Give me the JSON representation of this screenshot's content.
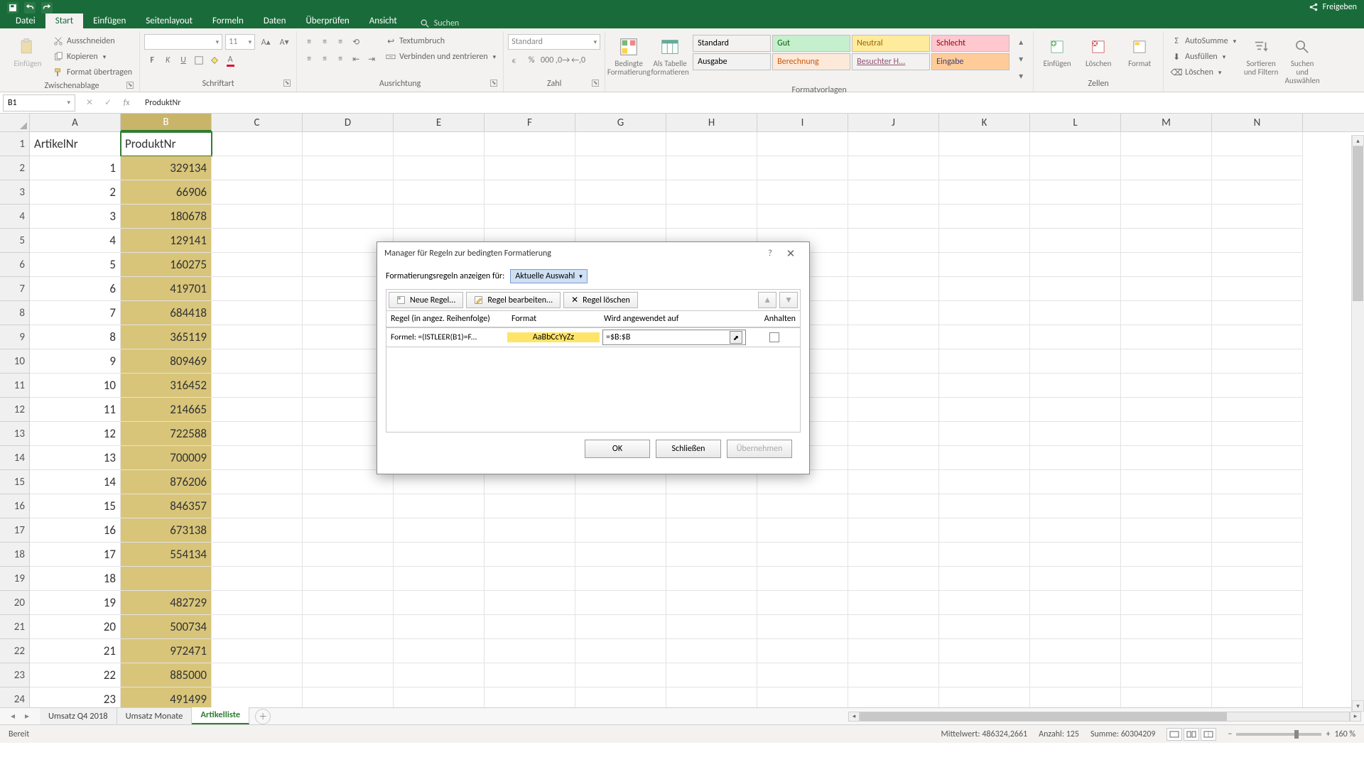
{
  "titlebar": {
    "share": "Freigeben"
  },
  "tabs": {
    "file": "Datei",
    "items": [
      "Start",
      "Einfügen",
      "Seitenlayout",
      "Formeln",
      "Daten",
      "Überprüfen",
      "Ansicht"
    ],
    "active": "Start",
    "search": "Suchen"
  },
  "ribbon": {
    "clipboard": {
      "label": "Zwischenablage",
      "paste": "Einfügen",
      "cut": "Ausschneiden",
      "copy": "Kopieren",
      "format_painter": "Format übertragen"
    },
    "font": {
      "label": "Schriftart",
      "font_name": "",
      "font_size": "11"
    },
    "alignment": {
      "label": "Ausrichtung",
      "wrap": "Textumbruch",
      "merge": "Verbinden und zentrieren"
    },
    "number": {
      "label": "Zahl",
      "format": "Standard"
    },
    "styles": {
      "label": "Formatvorlagen",
      "cond": "Bedingte Formatierung",
      "table": "Als Tabelle formatieren",
      "cells": {
        "standard": "Standard",
        "gut": "Gut",
        "neutral": "Neutral",
        "schlecht": "Schlecht",
        "ausgabe": "Ausgabe",
        "berechnung": "Berechnung",
        "besuchter": "Besuchter H...",
        "eingabe": "Eingabe"
      }
    },
    "cells_group": {
      "label": "Zellen",
      "insert": "Einfügen",
      "delete": "Löschen",
      "format": "Format"
    },
    "editing": {
      "autosum": "AutoSumme",
      "fill": "Ausfüllen",
      "clear": "Löschen",
      "sort": "Sortieren und Filtern",
      "find": "Suchen und Auswählen"
    }
  },
  "formula_bar": {
    "name_box": "B1",
    "formula": "ProduktNr"
  },
  "columns": [
    "A",
    "B",
    "C",
    "D",
    "E",
    "F",
    "G",
    "H",
    "I",
    "J",
    "K",
    "L",
    "M",
    "N"
  ],
  "selected_col": "B",
  "rows": [
    {
      "n": 1,
      "A": "ArtikelNr",
      "B": "ProduktNr",
      "isHeader": true
    },
    {
      "n": 2,
      "A": "1",
      "B": "329134"
    },
    {
      "n": 3,
      "A": "2",
      "B": "66906"
    },
    {
      "n": 4,
      "A": "3",
      "B": "180678"
    },
    {
      "n": 5,
      "A": "4",
      "B": "129141"
    },
    {
      "n": 6,
      "A": "5",
      "B": "160275"
    },
    {
      "n": 7,
      "A": "6",
      "B": "419701"
    },
    {
      "n": 8,
      "A": "7",
      "B": "684418"
    },
    {
      "n": 9,
      "A": "8",
      "B": "365119"
    },
    {
      "n": 10,
      "A": "9",
      "B": "809469"
    },
    {
      "n": 11,
      "A": "10",
      "B": "316452"
    },
    {
      "n": 12,
      "A": "11",
      "B": "214665"
    },
    {
      "n": 13,
      "A": "12",
      "B": "722588"
    },
    {
      "n": 14,
      "A": "13",
      "B": "700009"
    },
    {
      "n": 15,
      "A": "14",
      "B": "876206"
    },
    {
      "n": 16,
      "A": "15",
      "B": "846357"
    },
    {
      "n": 17,
      "A": "16",
      "B": "673138"
    },
    {
      "n": 18,
      "A": "17",
      "B": "554134"
    },
    {
      "n": 19,
      "A": "18",
      "B": ""
    },
    {
      "n": 20,
      "A": "19",
      "B": "482729"
    },
    {
      "n": 21,
      "A": "20",
      "B": "500734"
    },
    {
      "n": 22,
      "A": "21",
      "B": "972471"
    },
    {
      "n": 23,
      "A": "22",
      "B": "885000"
    },
    {
      "n": 24,
      "A": "23",
      "B": "491499"
    }
  ],
  "sheets": {
    "tabs": [
      "Umsatz Q4 2018",
      "Umsatz Monate",
      "Artikelliste"
    ],
    "active": "Artikelliste"
  },
  "statusbar": {
    "ready": "Bereit",
    "avg_label": "Mittelwert:",
    "avg": "486324,2661",
    "count_label": "Anzahl:",
    "count": "125",
    "sum_label": "Summe:",
    "sum": "60304209",
    "zoom": "160 %"
  },
  "dialog": {
    "title": "Manager für Regeln zur bedingten Formatierung",
    "show_for_label": "Formatierungsregeln anzeigen für:",
    "show_for_value": "Aktuelle Auswahl",
    "btn_new": "Neue Regel...",
    "btn_edit": "Regel bearbeiten...",
    "btn_delete": "Regel löschen",
    "col_rule": "Regel (in angez. Reihenfolge)",
    "col_format": "Format",
    "col_applies": "Wird angewendet auf",
    "col_stop": "Anhalten",
    "rule1_text": "Formel: =(ISTLEER(B1)=F...",
    "rule1_preview": "AaBbCcYyZz",
    "rule1_range": "=$B:$B",
    "ok": "OK",
    "close": "Schließen",
    "apply": "Übernehmen"
  }
}
